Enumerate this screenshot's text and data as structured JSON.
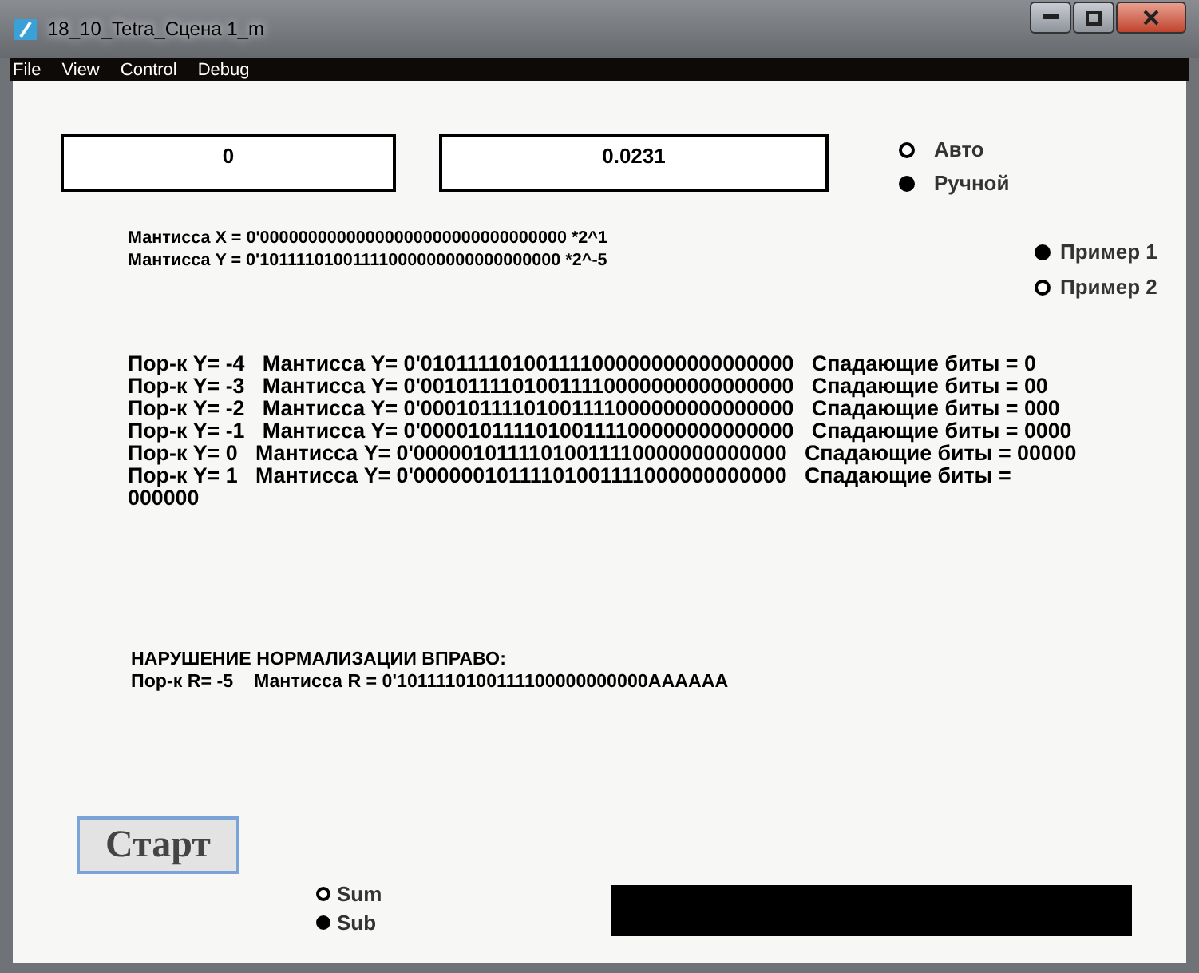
{
  "window": {
    "title": "18_10_Tetra_Сцена 1_m"
  },
  "menu": [
    {
      "label": "File"
    },
    {
      "label": "View"
    },
    {
      "label": "Control"
    },
    {
      "label": "Debug"
    }
  ],
  "displays": [
    {
      "value": "0"
    },
    {
      "value": "0.0231"
    }
  ],
  "mode_radios": [
    {
      "label": "Авто",
      "selected": false
    },
    {
      "label": "Ручной",
      "selected": true
    }
  ],
  "mantissas": [
    "Мантисса X = 0'00000000000000000000000000000000 *2^1",
    "Мантисса Y = 0'10111101001111000000000000000000 *2^-5"
  ],
  "example_radios": [
    {
      "label": "Пример 1",
      "selected": true
    },
    {
      "label": "Пример 2",
      "selected": false
    }
  ],
  "shift_rows": [
    "Пор-к Y= -4   Мантисса Y= 0'01011110100111100000000000000000   Спадающие биты = 0",
    "Пор-к Y= -3   Мантисса Y= 0'00101111010011110000000000000000   Спадающие биты = 00",
    "Пор-к Y= -2   Мантисса Y= 0'00010111101001111000000000000000   Спадающие биты = 000",
    "Пор-к Y= -1   Мантисса Y= 0'00001011110100111100000000000000   Спадающие биты = 0000",
    "Пор-к Y= 0   Мантисса Y= 0'00000101111010011110000000000000   Спадающие биты = 00000",
    "Пор-к Y= 1   Мантисса Y= 0'00000010111101001111000000000000   Спадающие биты = 000000"
  ],
  "violation": {
    "heading": "НАРУШЕНИЕ НОРМАЛИЗАЦИИ ВПРАВО:",
    "result": "Пор-к R= -5    Мантисса R = 0'1011110100111100000000000AAAAAA"
  },
  "start_button": {
    "label": "Старт"
  },
  "op_radios": [
    {
      "label": "Sum",
      "selected": false
    },
    {
      "label": "Sub",
      "selected": true
    }
  ]
}
